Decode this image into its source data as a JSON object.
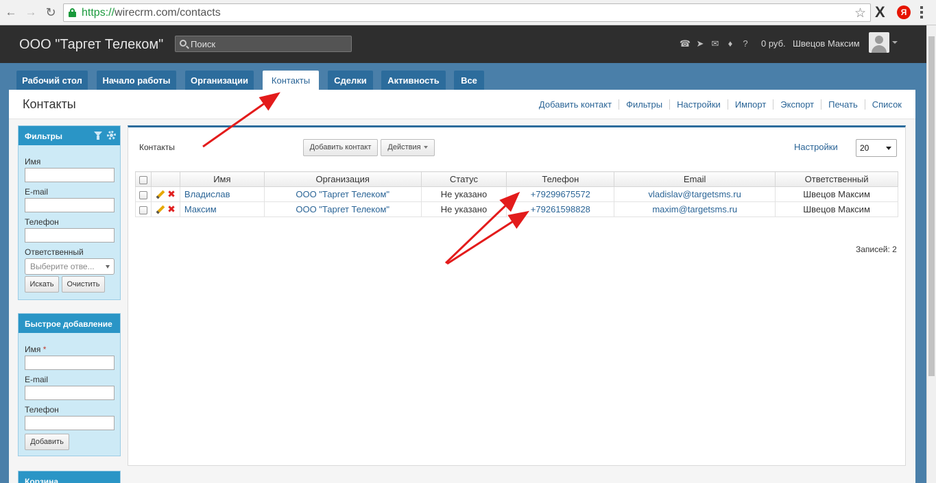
{
  "browser": {
    "url_scheme": "https://",
    "url_rest": "wirecrm.com/contacts",
    "extension_ya": "Я"
  },
  "header": {
    "company": "ООО \"Таргет Телеком\"",
    "search_placeholder": "Поиск",
    "balance": "0 руб.",
    "user_name": "Швецов Максим"
  },
  "tabs": [
    "Рабочий стол",
    "Начало работы",
    "Организации",
    "Контакты",
    "Сделки",
    "Активность",
    "Все"
  ],
  "page": {
    "title": "Контакты",
    "links": [
      "Добавить контакт",
      "Фильтры",
      "Настройки",
      "Импорт",
      "Экспорт",
      "Печать",
      "Список"
    ]
  },
  "filters": {
    "title": "Фильтры",
    "name_label": "Имя",
    "email_label": "E-mail",
    "phone_label": "Телефон",
    "owner_label": "Ответственный",
    "owner_placeholder": "Выберите отве...",
    "search_btn": "Искать",
    "clear_btn": "Очистить"
  },
  "quick_add": {
    "title": "Быстрое добавление",
    "name_label": "Имя",
    "required_mark": "*",
    "email_label": "E-mail",
    "phone_label": "Телефон",
    "add_btn": "Добавить"
  },
  "cart": {
    "title": "Корзина"
  },
  "main": {
    "label": "Контакты",
    "add_btn": "Добавить контакт",
    "actions_btn": "Действия",
    "settings_link": "Настройки",
    "per_page": "20",
    "records": "Записей: 2"
  },
  "table": {
    "columns": [
      "Имя",
      "Организация",
      "Статус",
      "Телефон",
      "Email",
      "Ответственный"
    ],
    "rows": [
      {
        "name": "Владислав",
        "org": "ООО \"Таргет Телеком\"",
        "status": "Не указано",
        "phone": "+79299675572",
        "email": "vladislav@targetsms.ru",
        "owner": "Швецов Максим"
      },
      {
        "name": "Максим",
        "org": "ООО \"Таргет Телеком\"",
        "status": "Не указано",
        "phone": "+79261598828",
        "email": "maxim@targetsms.ru",
        "owner": "Швецов Максим"
      }
    ]
  },
  "colors": {
    "accent": "#2c6c9c",
    "link": "#2a6496",
    "panel_header": "#2a95c6",
    "arrow": "#e31b1b"
  }
}
